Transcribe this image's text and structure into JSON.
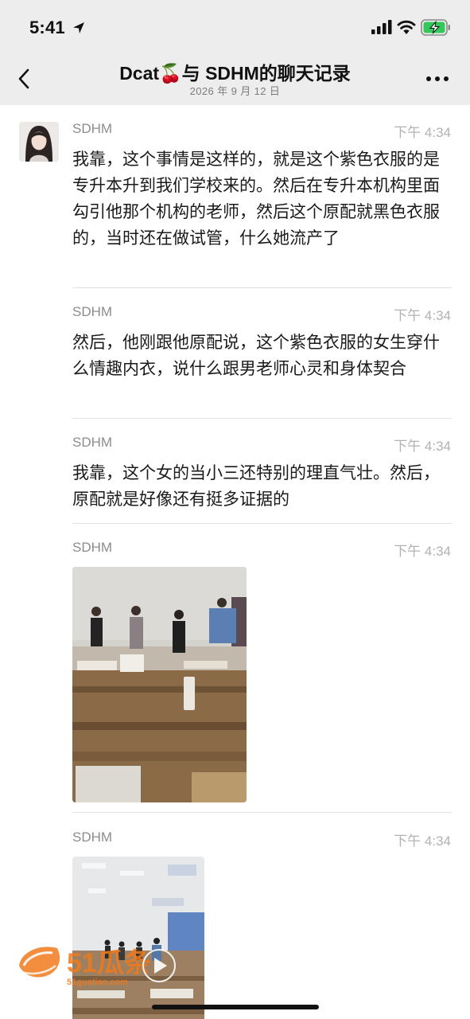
{
  "status_bar": {
    "time": "5:41"
  },
  "header": {
    "title": "Dcat🍒与 SDHM的聊天记录",
    "subtitle": "2026 年 9 月 12 日"
  },
  "messages": [
    {
      "sender": "SDHM",
      "time": "下午 4:34",
      "text": "我靠，这个事情是这样的，就是这个紫色衣服的是专升本升到我们学校来的。然后在专升本机构里面勾引他那个机构的老师，然后这个原配就黑色衣服的，当时还在做试管，什么她流产了"
    },
    {
      "sender": "SDHM",
      "time": "下午 4:34",
      "text": "然后，他刚跟他原配说，这个紫色衣服的女生穿什么情趣内衣，说什么跟男老师心灵和身体契合"
    },
    {
      "sender": "SDHM",
      "time": "下午 4:34",
      "text": "我靠，这个女的当小三还特别的理直气壮。然后，原配就是好像还有挺多证据的"
    },
    {
      "sender": "SDHM",
      "time": "下午 4:34",
      "type": "image"
    },
    {
      "sender": "SDHM",
      "time": "下午 4:34",
      "type": "image"
    }
  ],
  "watermark": {
    "brand": "51瓜条",
    "url": "51guatiao.com"
  }
}
